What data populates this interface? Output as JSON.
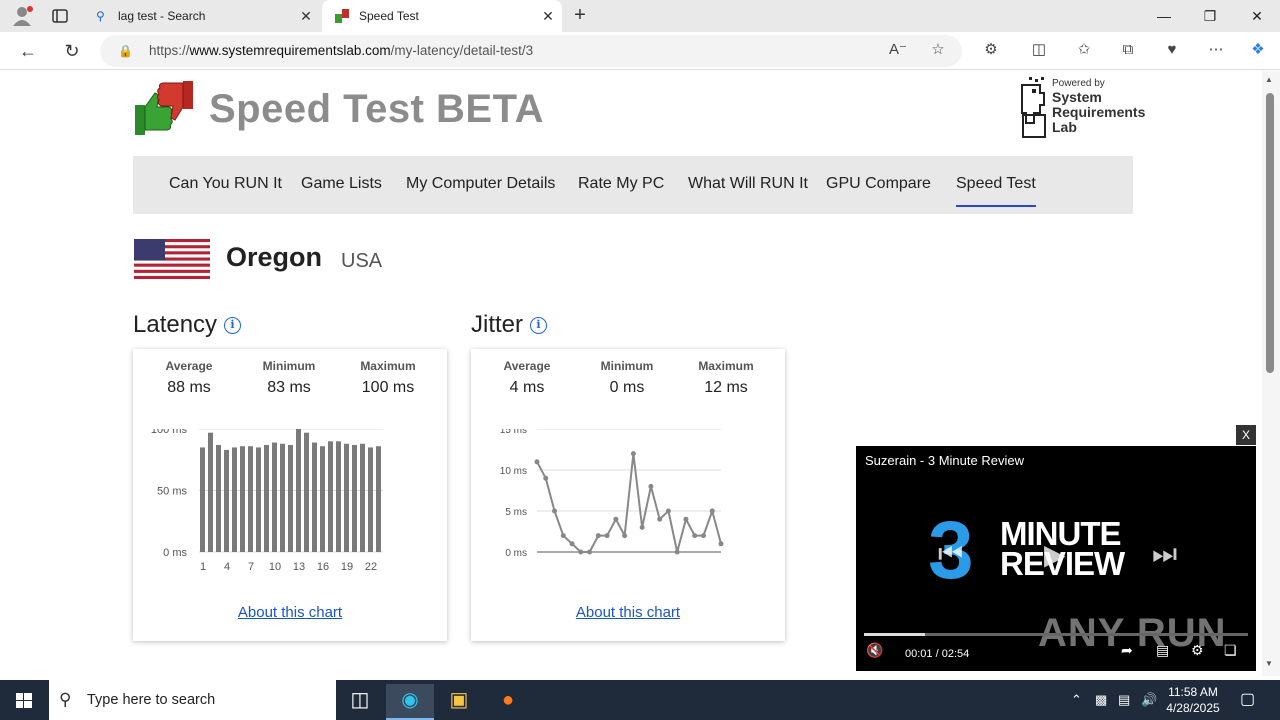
{
  "browser": {
    "tabs": [
      {
        "title": "lag test - Search"
      },
      {
        "title": "Speed Test"
      }
    ],
    "url_prefix": "https://",
    "url_host": "www.systemrequirementslab.com",
    "url_path": "/my-latency/detail-test/3"
  },
  "site": {
    "title": "Speed Test BETA",
    "powered_small": "Powered by",
    "powered_line1": "System",
    "powered_line2": "Requirements",
    "powered_line3": "Lab"
  },
  "nav": {
    "items": [
      "Can You RUN It",
      "Game Lists",
      "My Computer Details",
      "Rate My PC",
      "What Will RUN It",
      "GPU Compare",
      "Speed Test"
    ],
    "active": "Speed Test"
  },
  "location": {
    "city": "Oregon",
    "country": "USA"
  },
  "latency": {
    "title": "Latency",
    "avg_label": "Average",
    "avg_value": "88 ms",
    "min_label": "Minimum",
    "min_value": "83 ms",
    "max_label": "Maximum",
    "max_value": "100 ms",
    "about": "About this chart"
  },
  "jitter": {
    "title": "Jitter",
    "avg_label": "Average",
    "avg_value": "4 ms",
    "min_label": "Minimum",
    "min_value": "0 ms",
    "max_label": "Maximum",
    "max_value": "12 ms",
    "about": "About this chart"
  },
  "chart_data": [
    {
      "type": "bar",
      "title": "",
      "x": [
        1,
        2,
        3,
        4,
        5,
        6,
        7,
        8,
        9,
        10,
        11,
        12,
        13,
        14,
        15,
        16,
        17,
        18,
        19,
        20,
        21,
        22,
        23
      ],
      "xticks": [
        "1",
        "4",
        "7",
        "10",
        "13",
        "16",
        "19",
        "22"
      ],
      "values": [
        85,
        97,
        87,
        83,
        85,
        86,
        86,
        85,
        87,
        89,
        88,
        87,
        100,
        97,
        89,
        86,
        90,
        90,
        88,
        87,
        88,
        85,
        86
      ],
      "yticks": [
        "0 ms",
        "50 ms",
        "100 ms"
      ],
      "ylim": [
        0,
        100
      ],
      "color": "#7a7a7a"
    },
    {
      "type": "line",
      "title": "",
      "x": [
        1,
        2,
        3,
        4,
        5,
        6,
        7,
        8,
        9,
        10,
        11,
        12,
        13,
        14,
        15,
        16,
        17,
        18,
        19,
        20,
        21,
        22,
        23
      ],
      "values": [
        11,
        9,
        5,
        2,
        1,
        0,
        0,
        2,
        2,
        4,
        2,
        12,
        3,
        8,
        4,
        5,
        0,
        4,
        2,
        2,
        5,
        1
      ],
      "yticks": [
        "0 ms",
        "5 ms",
        "10 ms",
        "15 ms"
      ],
      "ylim": [
        0,
        15
      ],
      "color": "#888888"
    }
  ],
  "video": {
    "title": "Suzerain - 3 Minute Review",
    "big_num": "3",
    "big_line1": "MINUTE",
    "big_line2": "REVIEW",
    "current": "00:01",
    "sep": "/",
    "duration": "02:54",
    "progress": 0.16,
    "watermark": "ANY RUN",
    "close": "X"
  },
  "taskbar": {
    "search_placeholder": "Type here to search",
    "time": "11:58 AM",
    "date": "4/28/2025"
  }
}
